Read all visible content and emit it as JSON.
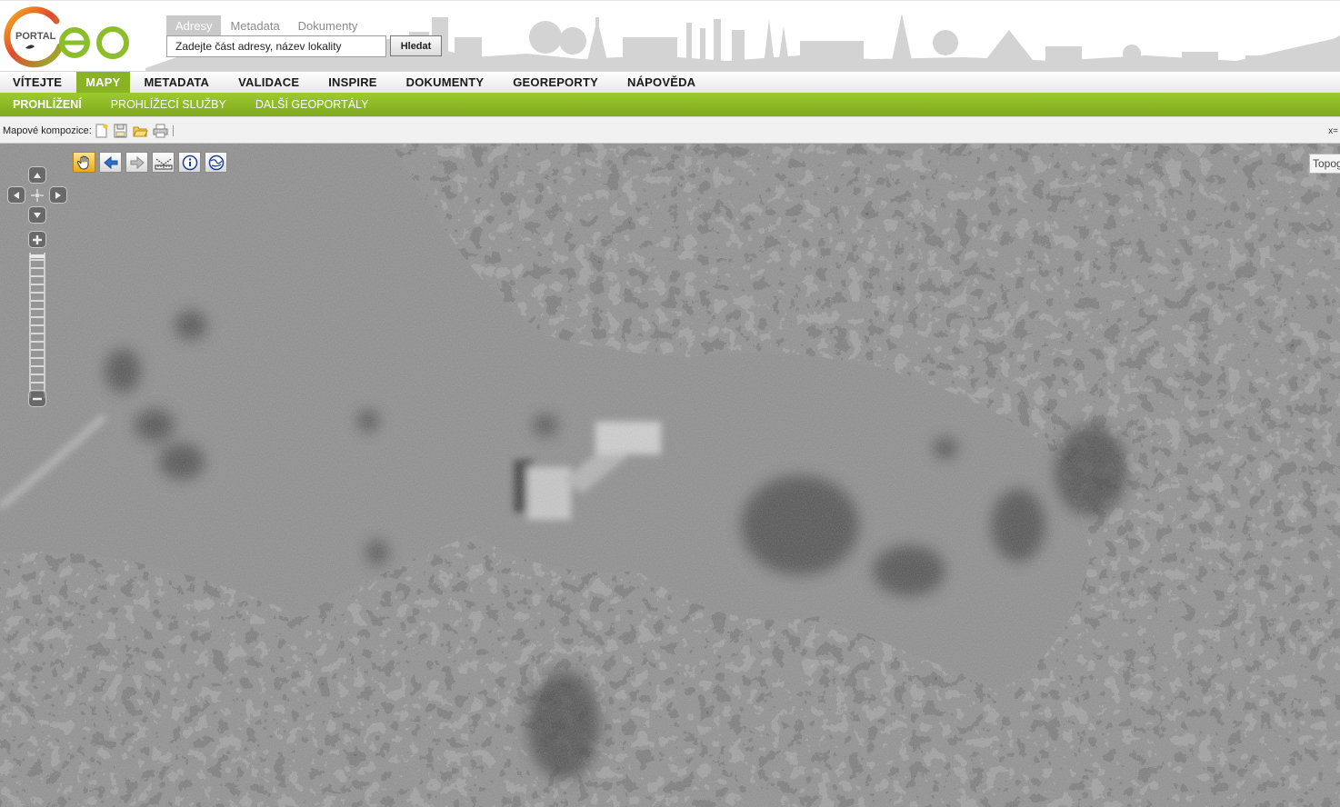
{
  "header": {
    "logo_small": "PORTAL",
    "logo_big": "Geo",
    "search_tabs": [
      "Adresy",
      "Metadata",
      "Dokumenty"
    ],
    "search_placeholder": "Zadejte část adresy, název lokality",
    "search_button": "Hledat"
  },
  "main_nav": [
    "VÍTEJTE",
    "MAPY",
    "METADATA",
    "VALIDACE",
    "INSPIRE",
    "DOKUMENTY",
    "GEOREPORTY",
    "NÁPOVĚDA"
  ],
  "main_nav_active": "MAPY",
  "sub_nav": [
    "PROHLÍŽENÍ",
    "PROHLÍŽECÍ SLUŽBY",
    "DALŠÍ GEOPORTÁLY"
  ],
  "sub_nav_active": "PROHLÍŽENÍ",
  "composition_bar": {
    "label": "Mapové kompozice:",
    "buttons": [
      "new-composition-icon",
      "save-composition-icon",
      "open-composition-icon",
      "print-icon"
    ],
    "coordinate_label": "x="
  },
  "map": {
    "tools": [
      "pan-hand-icon",
      "back-arrow-icon",
      "forward-arrow-icon",
      "measure-ruler-icon",
      "info-icon",
      "globe-icon"
    ],
    "active_tool": "pan-hand-icon",
    "layer_switcher": "Topog"
  },
  "colors": {
    "brand_green": "#88b323",
    "subnav_green": "#8dbb26",
    "logo_orange": "#f0a018",
    "logo_red": "#e5482e",
    "logo_green": "#8cbd2a"
  }
}
